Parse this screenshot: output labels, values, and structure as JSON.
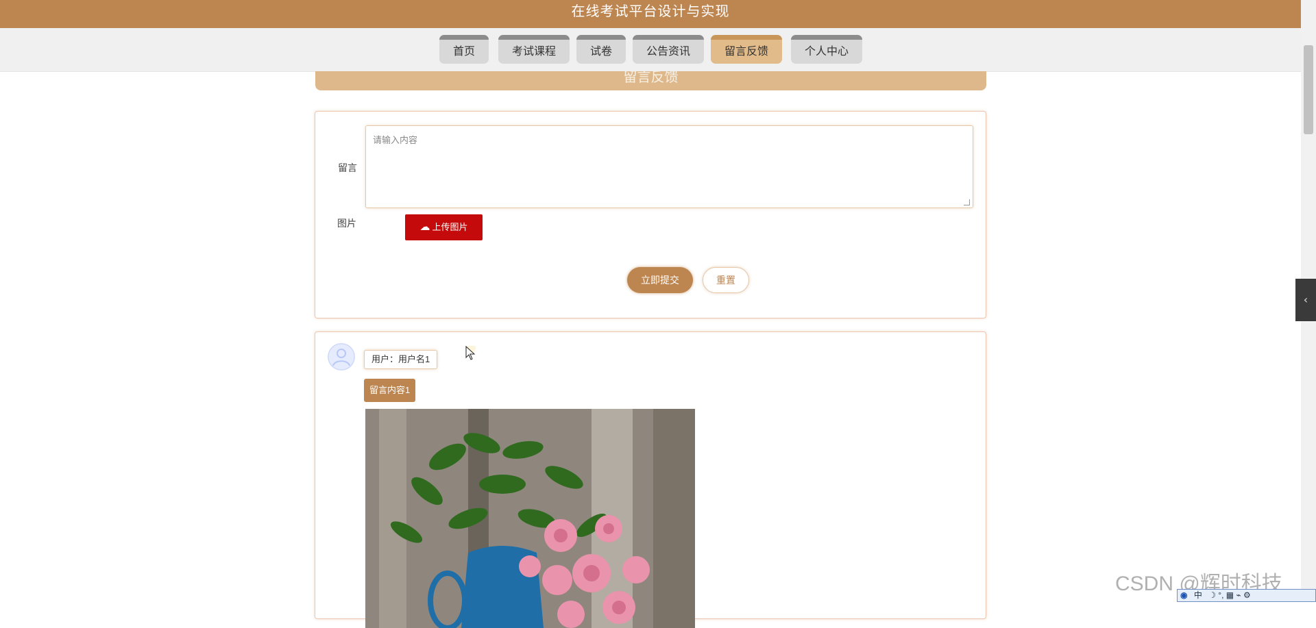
{
  "app_title": "在线考试平台设计与实现",
  "nav": {
    "items": [
      {
        "label": "首页",
        "active": false
      },
      {
        "label": "考试课程",
        "active": false
      },
      {
        "label": "试卷",
        "active": false
      },
      {
        "label": "公告资讯",
        "active": false
      },
      {
        "label": "留言反馈",
        "active": true
      },
      {
        "label": "个人中心",
        "active": false
      }
    ]
  },
  "section_title": "留言反馈",
  "form": {
    "message_label": "留言",
    "message_placeholder": "请输入内容",
    "image_label": "图片",
    "upload_label": "上传图片",
    "submit_label": "立即提交",
    "reset_label": "重置"
  },
  "comments": [
    {
      "user": "用户：用户名1",
      "content": "留言内容1"
    }
  ],
  "watermark": "CSDN @辉时科技",
  "tray": {
    "ime_mode": "中"
  },
  "colors": {
    "brand": "#bd8550",
    "banner": "#deb88b",
    "upload": "#c40a0a"
  },
  "icons": [
    "cloud-upload-icon",
    "user-avatar-icon",
    "chevron-left-icon",
    "mouse-cursor-icon"
  ]
}
